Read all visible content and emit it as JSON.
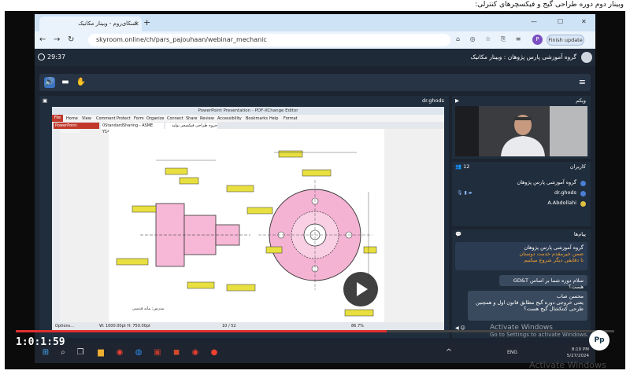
{
  "caption": "وبینار دوم دوره طراحی گیج و فیکسچرهای کنترلی:",
  "browser": {
    "tab_title": "اسکای‌روم - وبینار مکانیک",
    "url": "skyroom.online/ch/pars_pajouhaan/webinar_mechanic",
    "profile_initial": "P",
    "update_button": "Finish update"
  },
  "app": {
    "timer": "29:37",
    "room_title": "گروه آموزشی پارس پژوهان : وبینار مکانیک",
    "presenter_name": "dr.ghods"
  },
  "presentation": {
    "window_title": "PowerPoint Presentation - PDF-XChange Editor",
    "menu": [
      "File",
      "Home",
      "View",
      "Comment",
      "Protect",
      "Form",
      "Organize",
      "Connect",
      "Share",
      "Review",
      "Accessibility",
      "Bookmarks",
      "Help",
      "Format"
    ],
    "tabs": [
      "PowerPoint Presentation",
      "0StandardSharing - ASME Y14.5-2018",
      "جزوه طراحی فیکسچر تولید"
    ],
    "page_caption": "مدرس: مایه قدسی",
    "status_options": "Options...",
    "status_dims": "W: 1000.00pt  H: 750.00pt",
    "zoom": "86.7%",
    "page_num": "10 / 52"
  },
  "webcam": {
    "title": "وبکم"
  },
  "users": {
    "title": "کاربران",
    "count": "12",
    "list": [
      "گروه آموزشی پارس پژوهان",
      "dr.ghods",
      "A.Abdollahi"
    ]
  },
  "messages": {
    "title": "پیام‌ها",
    "items": [
      {
        "sender": "گروه آموزشی پارس پژوهان",
        "line1": "ضمن خیرمقدم خدمت دوستان",
        "line2": "تا دقایقی دیگر شروع میکنیم"
      },
      {
        "text": "سلام دوره شما بر اساس GD&T هست؟"
      },
      {
        "sender": "محسن صاب",
        "text": "یعنی خروجی دوره گیج مطابق قانون اول و همچنین طرحی کنتکشال گیج هست؟"
      }
    ],
    "input_placeholder": "پیام خود را بنویسید",
    "activate_line1": "Activate Windows",
    "activate_line2": "Go to Settings to activate Windows."
  },
  "player": {
    "time": "1:0:1:59",
    "progress": 0.62,
    "logo": "Pp"
  },
  "taskbar": {
    "lang": "ENG",
    "time": "8:10 PM",
    "date": "5/27/2024"
  },
  "watermark": "Activate Windows"
}
